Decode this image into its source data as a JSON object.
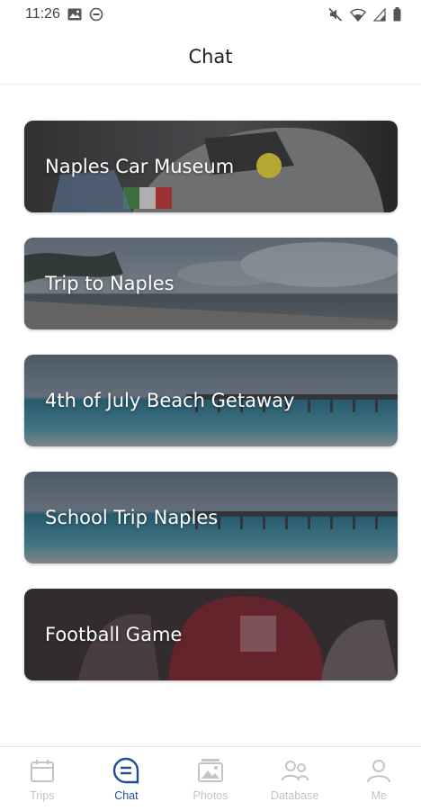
{
  "status_bar": {
    "time": "11:26",
    "left_icons": [
      "image-icon",
      "do-not-disturb-icon"
    ],
    "right_icons": [
      "mute-icon",
      "wifi-icon",
      "signal-icon",
      "battery-icon"
    ]
  },
  "header": {
    "title": "Chat"
  },
  "chats": [
    {
      "label": "Naples Car Museum",
      "theme": "car"
    },
    {
      "label": "Trip to Naples",
      "theme": "beach-palm"
    },
    {
      "label": "4th of July Beach Getaway",
      "theme": "pier"
    },
    {
      "label": "School Trip Naples",
      "theme": "pier"
    },
    {
      "label": "Football Game",
      "theme": "football"
    }
  ],
  "nav": {
    "items": [
      {
        "label": "Trips",
        "icon": "calendar-icon",
        "active": false
      },
      {
        "label": "Chat",
        "icon": "chat-bubble-icon",
        "active": true
      },
      {
        "label": "Photos",
        "icon": "photos-icon",
        "active": false
      },
      {
        "label": "Database",
        "icon": "people-icon",
        "active": false
      },
      {
        "label": "Me",
        "icon": "user-icon",
        "active": false
      }
    ]
  },
  "colors": {
    "accent": "#1e4f96",
    "inactive": "#c4c4c4"
  }
}
